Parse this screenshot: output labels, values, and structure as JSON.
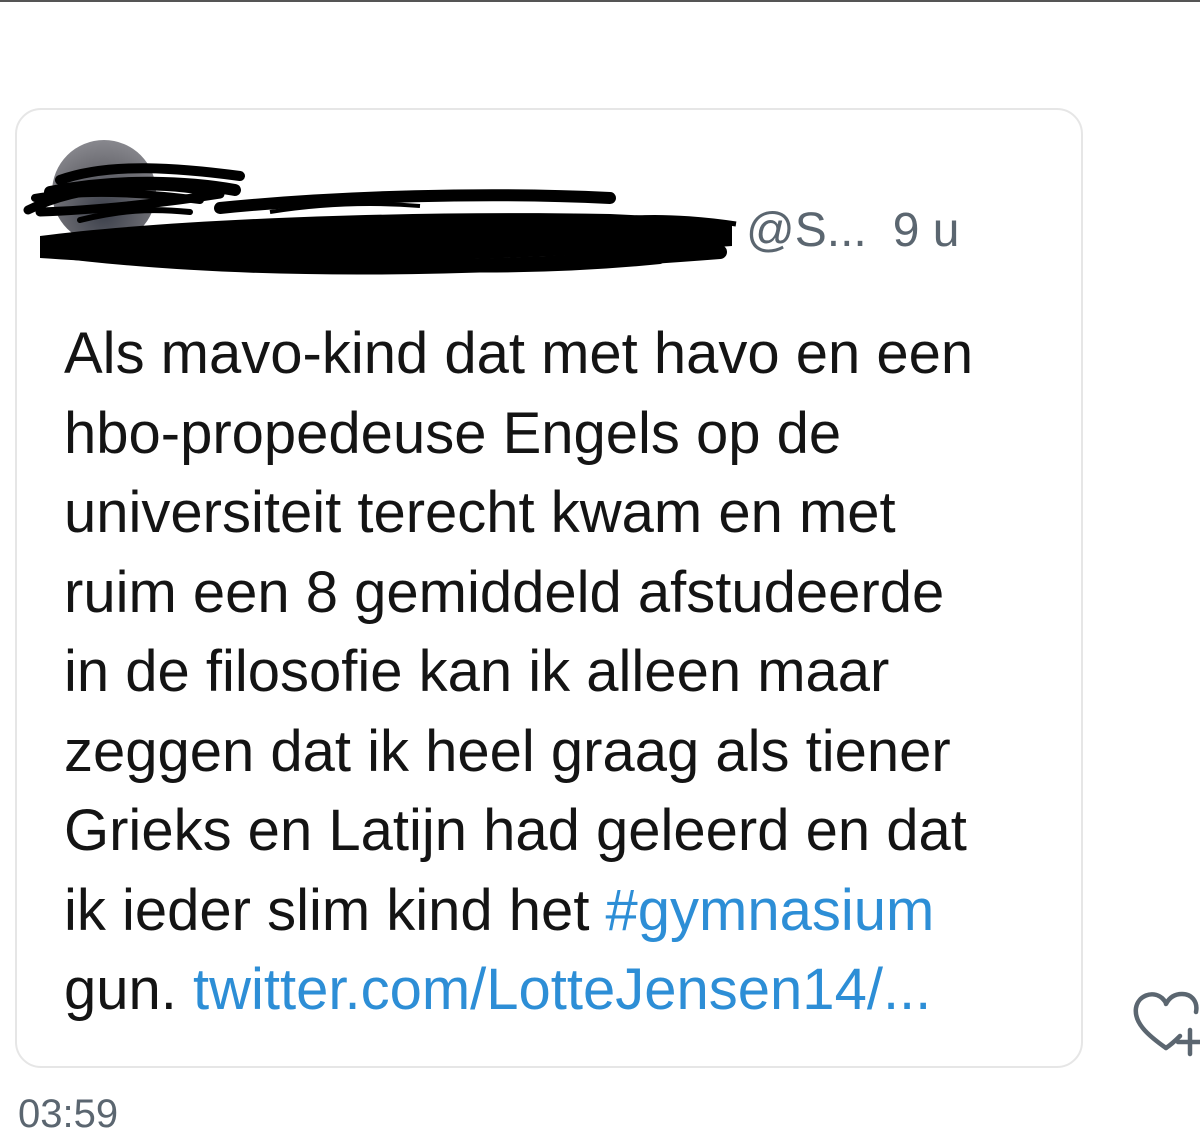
{
  "tweet": {
    "handle": "@S...",
    "time_ago": "9 u",
    "text_lines": [
      "Als mavo-kind dat met havo en een",
      "hbo-propedeuse Engels op de",
      "universiteit terecht kwam en met",
      "ruim een 8 gemiddeld afstudeerde",
      "in de filosofie kan ik alleen maar",
      "zeggen dat ik heel graag als tiener",
      "Grieks en Latijn had geleerd en dat",
      "ik ieder slim kind het "
    ],
    "hashtag": "#gymnasium",
    "last_line_prefix": "gun. ",
    "link": "twitter.com/LotteJensen14/..."
  },
  "clock": "03:59",
  "icons": {
    "avatar": "avatar",
    "like": "heart-plus-icon",
    "redaction": "scribble-redaction"
  },
  "colors": {
    "text": "#141414",
    "muted": "#5b6670",
    "link": "#2d8ed6",
    "card_border": "#e6e6e6"
  }
}
